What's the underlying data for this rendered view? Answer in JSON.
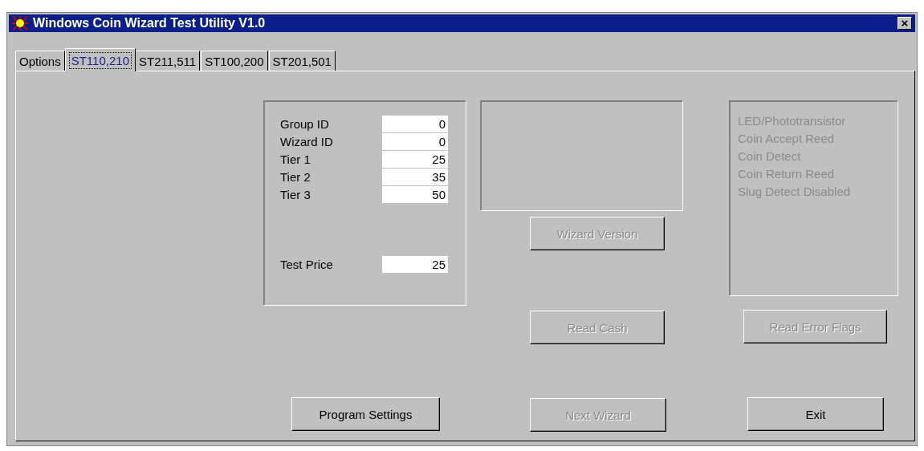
{
  "window": {
    "title": "Windows Coin Wizard Test Utility V1.0",
    "close": "×"
  },
  "tabs": [
    {
      "label": "Options",
      "selected": false
    },
    {
      "label": "ST110,210",
      "selected": true
    },
    {
      "label": "ST211,511",
      "selected": false
    },
    {
      "label": "ST100,200",
      "selected": false
    },
    {
      "label": "ST201,501",
      "selected": false
    }
  ],
  "settings": {
    "fields": [
      {
        "label": "Group ID",
        "value": "0"
      },
      {
        "label": "Wizard ID",
        "value": "0"
      },
      {
        "label": "Tier 1",
        "value": "25"
      },
      {
        "label": "Tier 2",
        "value": "35"
      },
      {
        "label": "Tier 3",
        "value": "50"
      },
      {
        "label": "Test Price",
        "value": "25"
      }
    ],
    "button": {
      "label": "Program Settings",
      "disabled": false
    }
  },
  "version": {
    "buttons": [
      {
        "label": "Wizard Version",
        "disabled": true
      },
      {
        "label": "Read Cash",
        "disabled": true
      },
      {
        "label": "Next Wizard",
        "disabled": true
      }
    ]
  },
  "error_flags": {
    "flags": [
      {
        "label": "LED/Phototransistor",
        "disabled": true
      },
      {
        "label": "Coin Accept Reed",
        "disabled": true
      },
      {
        "label": "Coin Detect",
        "disabled": true
      },
      {
        "label": "Coin Return Reed",
        "disabled": true
      },
      {
        "label": "Slug Detect Disabled",
        "disabled": true
      }
    ],
    "buttons": [
      {
        "label": "Read Error Flags",
        "disabled": true
      },
      {
        "label": "Exit",
        "disabled": false
      }
    ]
  }
}
